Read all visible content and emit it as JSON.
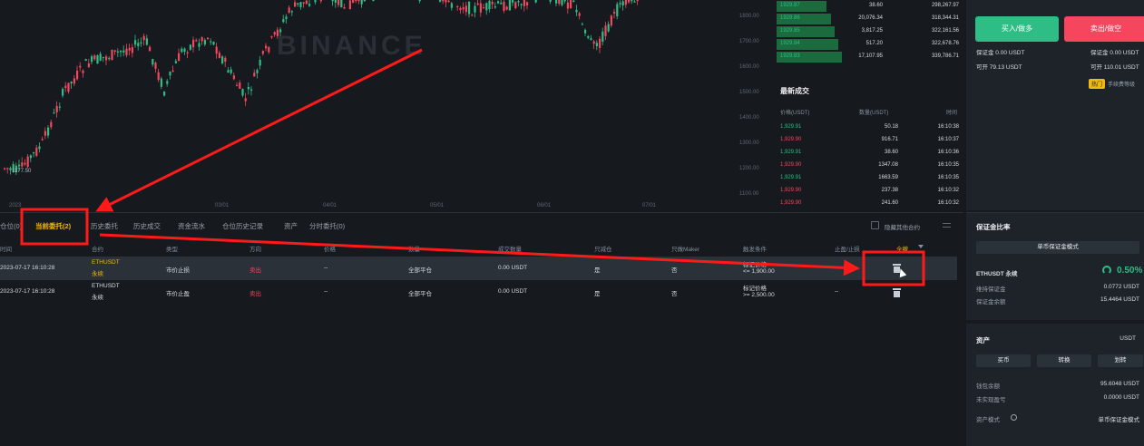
{
  "chart": {
    "price_labels": [
      "1800.00",
      "1700.00",
      "1600.00",
      "1500.00",
      "1400.00",
      "1300.00",
      "1200.00",
      "1100.00"
    ],
    "date_labels": [
      "2023",
      "03/01",
      "04/01",
      "05/01",
      "06/01",
      "07/01"
    ],
    "low_marker": "1177.50",
    "watermark": "BINANCE"
  },
  "orderbook": {
    "rows": [
      {
        "price": "1929.87",
        "qty": "38.60",
        "total": "298,267.97"
      },
      {
        "price": "1929.86",
        "qty": "20,076.34",
        "total": "318,344.31"
      },
      {
        "price": "1929.85",
        "qty": "3,817.25",
        "total": "322,161.56"
      },
      {
        "price": "1929.84",
        "qty": "517.20",
        "total": "322,678.76"
      },
      {
        "price": "1929.83",
        "qty": "17,107.95",
        "total": "339,786.71"
      }
    ]
  },
  "trades": {
    "title": "最新成交",
    "headers": {
      "price": "价格(USDT)",
      "qty": "数量(USDT)",
      "time": "时间"
    },
    "rows": [
      {
        "price": "1,929.91",
        "qty": "50.18",
        "time": "16:10:38",
        "dir": "up"
      },
      {
        "price": "1,929.90",
        "qty": "916.71",
        "time": "16:10:37",
        "dir": "down"
      },
      {
        "price": "1,929.91",
        "qty": "38.60",
        "time": "16:10:36",
        "dir": "up"
      },
      {
        "price": "1,929.90",
        "qty": "1347.08",
        "time": "16:10:35",
        "dir": "down"
      },
      {
        "price": "1,929.91",
        "qty": "1663.59",
        "time": "16:10:35",
        "dir": "up"
      },
      {
        "price": "1,929.90",
        "qty": "237.38",
        "time": "16:10:32",
        "dir": "down"
      },
      {
        "price": "1,929.90",
        "qty": "241.60",
        "time": "16:10:32",
        "dir": "down"
      }
    ]
  },
  "trade_panel": {
    "buy_label": "买入/做多",
    "sell_label": "卖出/做空",
    "buy_margin": "保证金 0.00 USDT",
    "buy_available": "可开 79.13 USDT",
    "sell_margin": "保证金 0.00 USDT",
    "sell_available": "可开 110.01 USDT",
    "badge": "热门",
    "fee_link": "手续费等级"
  },
  "orders": {
    "tabs": [
      "仓位(0)",
      "当前委托(2)",
      "历史委托",
      "历史成交",
      "资金流水",
      "仓位历史记录",
      "资产",
      "分时委托(0)"
    ],
    "hide_other": "隐藏其他合约",
    "columns": [
      "时间",
      "合约",
      "类型",
      "方向",
      "价格",
      "数量",
      "成交数量",
      "只减仓",
      "只做Maker",
      "触发条件",
      "止盈/止损",
      "全撤"
    ],
    "rows": [
      {
        "time": "2023-07-17 16:10:28",
        "symbol": "ETHUSDT",
        "kind": "永续",
        "type": "市价止损",
        "side": "卖出",
        "price": "--",
        "amount": "全部平仓",
        "filled": "0.00 USDT",
        "reduce_only": "是",
        "maker_only": "否",
        "trigger_1": "标记价格",
        "trigger_2": "<= 1,900.00",
        "tpsl": ""
      },
      {
        "time": "2023-07-17 16:10:28",
        "symbol": "ETHUSDT",
        "kind": "永续",
        "type": "市价止盈",
        "side": "卖出",
        "price": "--",
        "amount": "全部平仓",
        "filled": "0.00 USDT",
        "reduce_only": "是",
        "maker_only": "否",
        "trigger_1": "标记价格",
        "trigger_2": ">= 2,500.00",
        "tpsl": "--"
      }
    ]
  },
  "margin_panel": {
    "title": "保证金比率",
    "mode_button": "单币保证金模式",
    "symbol": "ETHUSDT 永续",
    "ratio": "0.50%",
    "maint_label": "维持保证金",
    "maint_value": "0.0772 USDT",
    "balance_label": "保证金余额",
    "balance_value": "15.4464 USDT",
    "assets_title": "资产",
    "assets_unit": "USDT",
    "btn_buy": "买币",
    "btn_convert": "转换",
    "btn_transfer": "划转",
    "wallet_label": "钱包余额",
    "wallet_value": "95.6048 USDT",
    "unrealized_label": "未实现盈亏",
    "unrealized_value": "0.0000 USDT",
    "asset_mode_label": "资产模式",
    "asset_mode_value": "单币保证金模式"
  },
  "colors": {
    "up": "#2ebd85",
    "down": "#f6465d",
    "accent": "#f0b90b",
    "annotation": "#ff1a1a"
  }
}
